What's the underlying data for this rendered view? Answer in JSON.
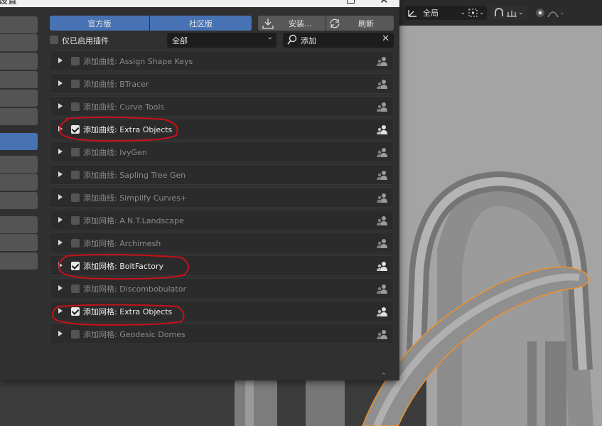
{
  "window": {
    "title": "设置"
  },
  "tabs": {
    "official": "官方版",
    "community": "社区版",
    "install": "安装...",
    "refresh": "刷新"
  },
  "filters": {
    "enabled_only_label": "仅已启用插件",
    "category_value": "全部",
    "search_value": "添加"
  },
  "addons": [
    {
      "label": "添加曲线: Assign Shape Keys",
      "enabled": false
    },
    {
      "label": "添加曲线: BTracer",
      "enabled": false
    },
    {
      "label": "添加曲线: Curve Tools",
      "enabled": false
    },
    {
      "label": "添加曲线: Extra Objects",
      "enabled": true
    },
    {
      "label": "添加曲线: IvyGen",
      "enabled": false
    },
    {
      "label": "添加曲线: Sapling Tree Gen",
      "enabled": false
    },
    {
      "label": "添加曲线: Simplify Curves+",
      "enabled": false
    },
    {
      "label": "添加网格: A.N.T.Landscape",
      "enabled": false
    },
    {
      "label": "添加网格: Archimesh",
      "enabled": false
    },
    {
      "label": "添加网格: BoltFactory",
      "enabled": true
    },
    {
      "label": "添加网格: Discombobulator",
      "enabled": false
    },
    {
      "label": "添加网格: Extra Objects",
      "enabled": true
    },
    {
      "label": "添加网格: Geodesic Domes",
      "enabled": false
    }
  ],
  "viewport_header": {
    "transform_orientation": "全局"
  },
  "colors": {
    "accent_blue": "#4772b3",
    "annotation_red": "#c8101a",
    "selection_orange": "#f0902a"
  }
}
